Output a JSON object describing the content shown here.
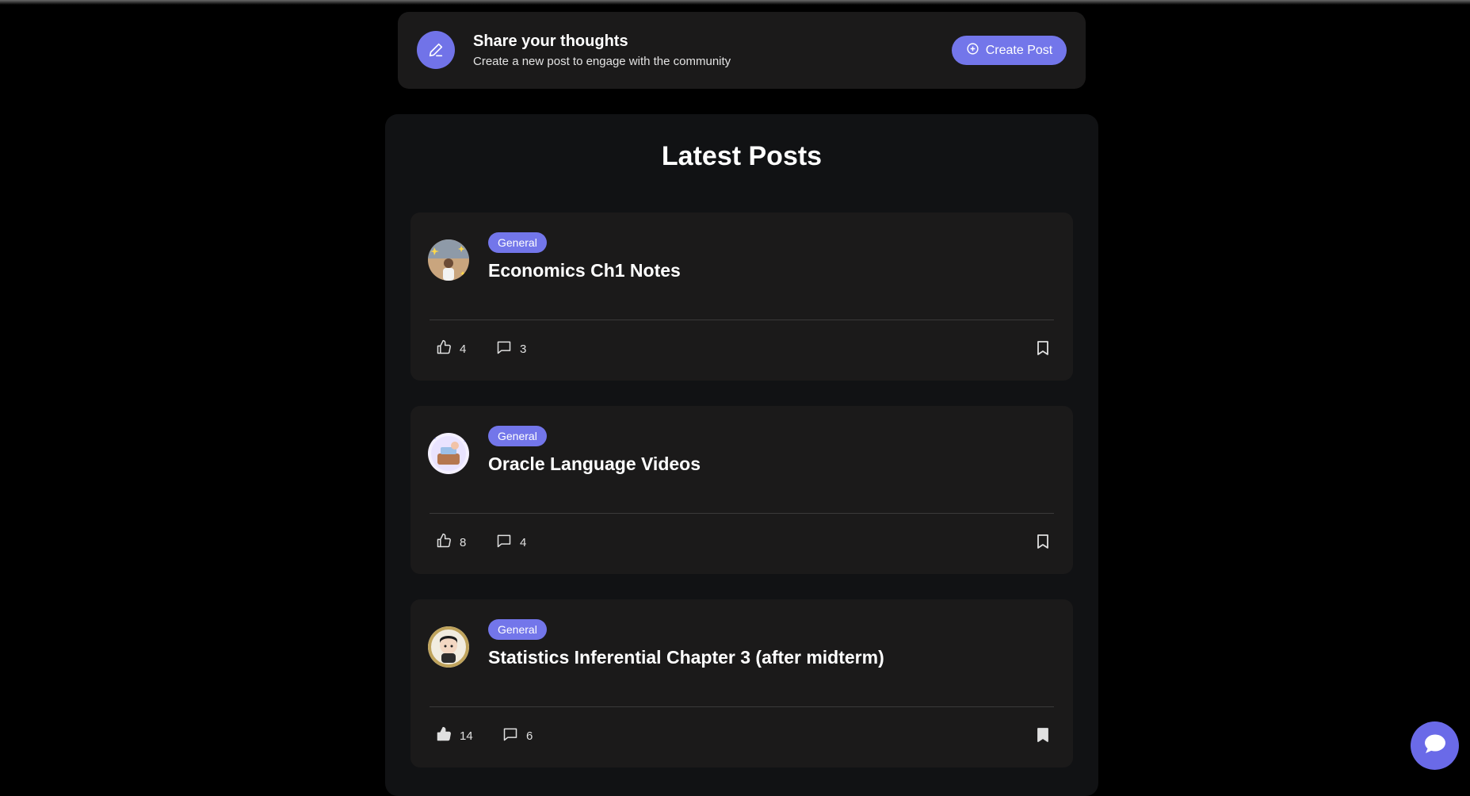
{
  "composer": {
    "title": "Share your thoughts",
    "subtitle": "Create a new post to engage with the community",
    "create_label": "Create Post"
  },
  "feed": {
    "title": "Latest Posts",
    "posts": [
      {
        "category": "General",
        "title": "Economics Ch1 Notes",
        "likes": "4",
        "comments": "3",
        "liked": false,
        "bookmarked": false
      },
      {
        "category": "General",
        "title": "Oracle Language Videos",
        "likes": "8",
        "comments": "4",
        "liked": false,
        "bookmarked": false
      },
      {
        "category": "General",
        "title": "Statistics Inferential Chapter 3 (after midterm)",
        "likes": "14",
        "comments": "6",
        "liked": true,
        "bookmarked": true
      }
    ]
  },
  "colors": {
    "accent": "#7376ea",
    "card": "#1b1a1a",
    "feed_bg": "#111214"
  },
  "icons": [
    "pen-icon",
    "plus-circle-icon",
    "thumbs-up-icon",
    "comment-icon",
    "bookmark-icon",
    "chat-icon"
  ]
}
